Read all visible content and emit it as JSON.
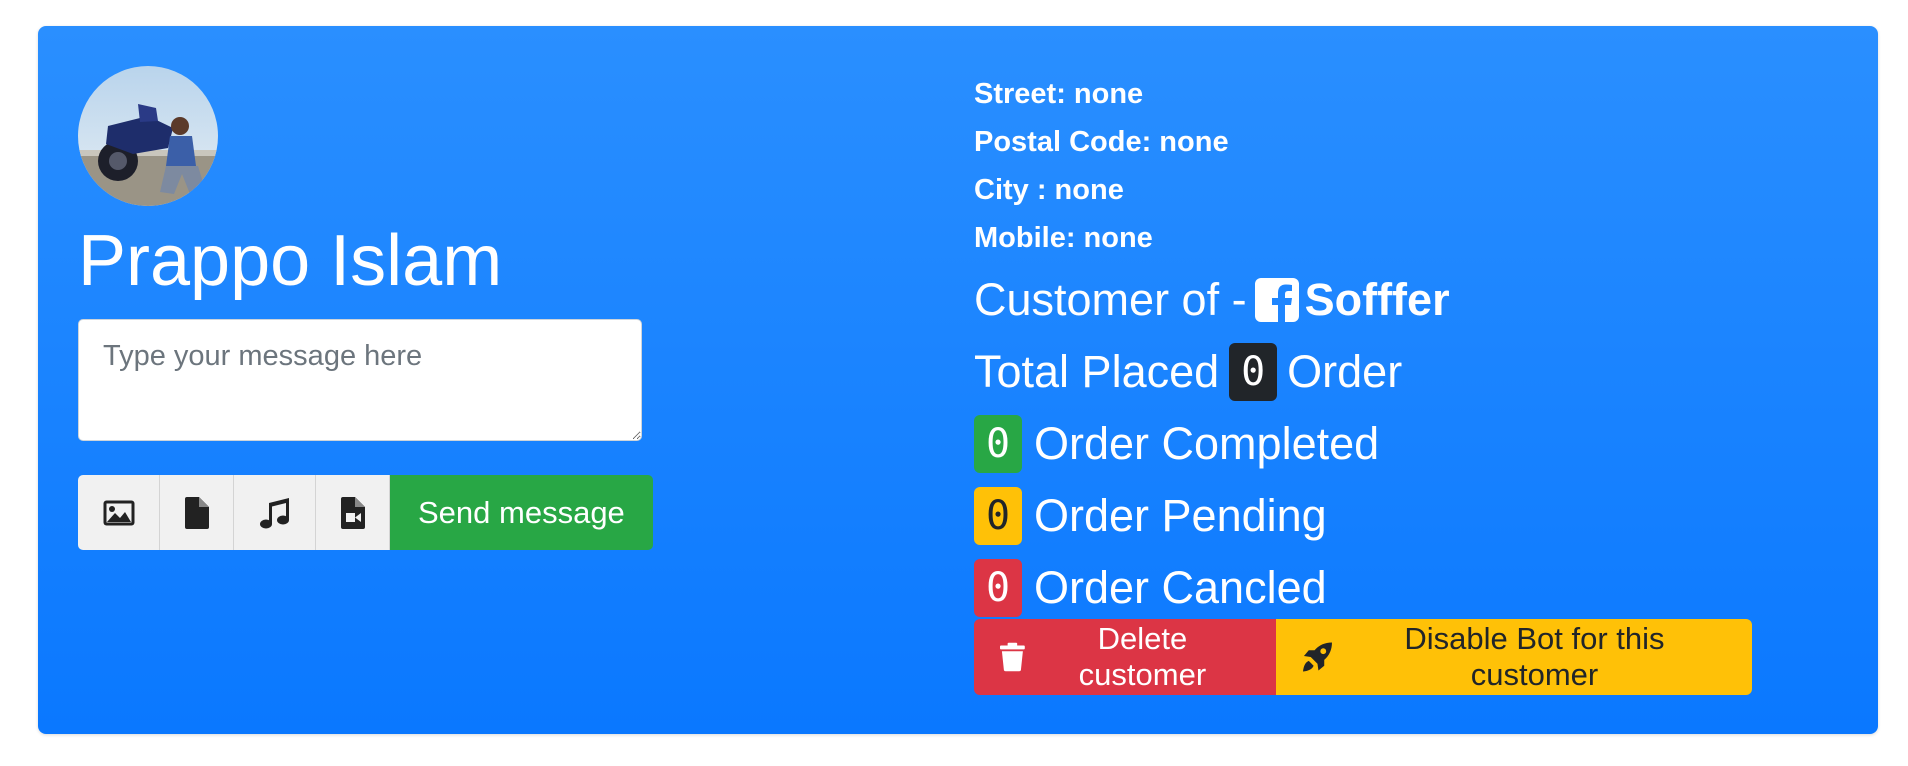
{
  "profile": {
    "name": "Prappo Islam",
    "message_placeholder": "Type your message here"
  },
  "attachments": {
    "image_icon": "image-icon",
    "file_icon": "file-icon",
    "audio_icon": "music-icon",
    "video_icon": "file-video-icon",
    "send_label": "Send message"
  },
  "address": {
    "street": "Street: none",
    "postal": "Postal Code: none",
    "city": "City : none",
    "mobile": "Mobile: none"
  },
  "customer_of": {
    "prefix": "Customer of -",
    "page_name": "Sofffer",
    "icon": "facebook-icon"
  },
  "orders": {
    "total_prefix": "Total Placed",
    "total_count": "0",
    "total_suffix": "Order",
    "completed_count": "0",
    "completed_label": "Order Completed",
    "pending_count": "0",
    "pending_label": "Order Pending",
    "canceled_count": "0",
    "canceled_label": "Order Cancled"
  },
  "actions": {
    "delete_label": "Delete customer",
    "disable_label": "Disable Bot for this customer"
  },
  "colors": {
    "card": "#1f86ff",
    "success": "#28a745",
    "warning": "#ffc107",
    "danger": "#dc3545",
    "dark": "#212529"
  }
}
